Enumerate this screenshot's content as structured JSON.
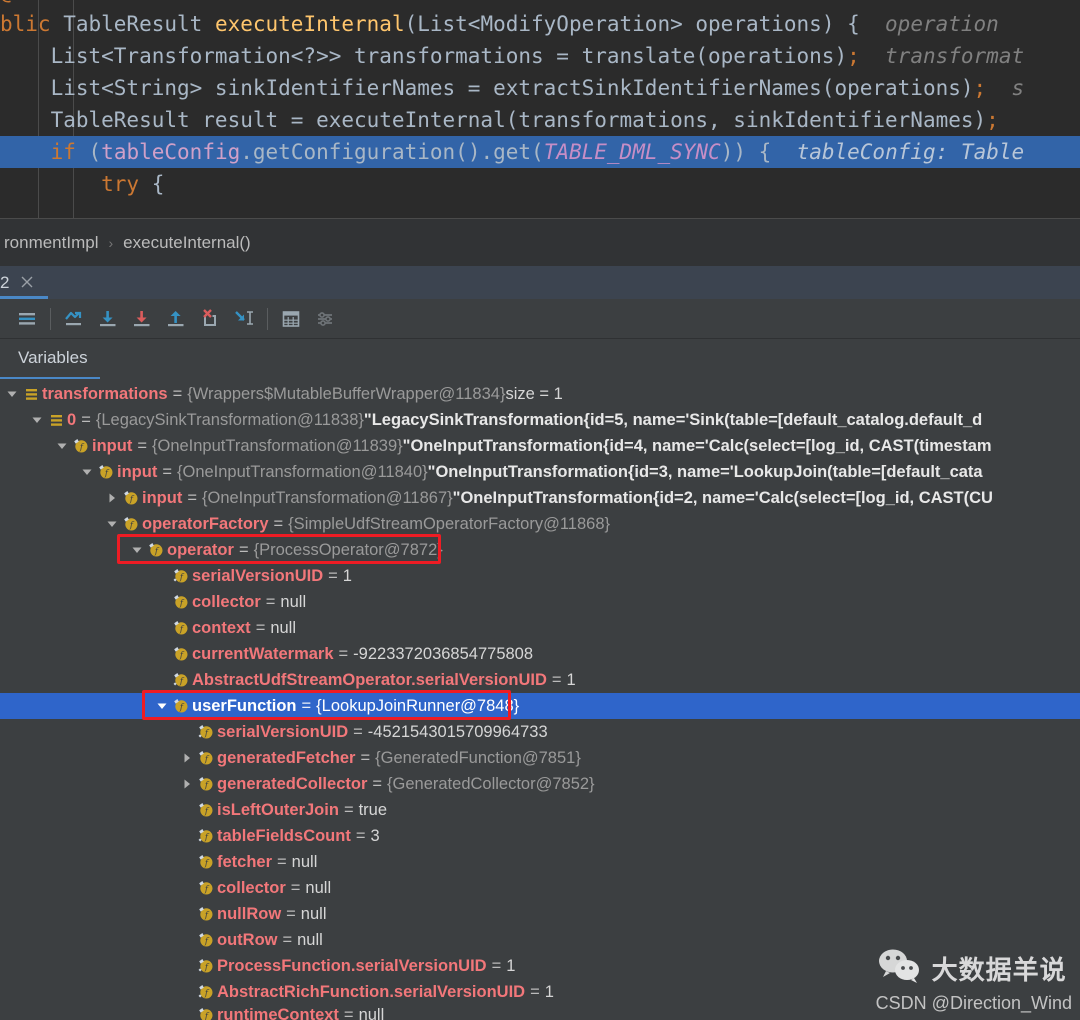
{
  "app": "IntelliJ IDEA Debugger",
  "editor": {
    "lines": [
      {
        "id": "line-override",
        "clipped_top": true,
        "selected": false,
        "segments": [
          {
            "cls": "kw",
            "t": "@Override"
          }
        ],
        "hint": ""
      },
      {
        "id": "line-signature",
        "selected": false,
        "segments": [
          {
            "cls": "kw",
            "t": "blic "
          },
          {
            "cls": "plain",
            "t": "TableResult "
          },
          {
            "cls": "mth",
            "t": "executeInternal"
          },
          {
            "cls": "plain",
            "t": "(List<ModifyOperation> operations) {"
          }
        ],
        "hint": "operation"
      },
      {
        "id": "line-transformations",
        "selected": false,
        "segments": [
          {
            "cls": "plain",
            "t": "    List<Transformation<?>> transformations = translate(operations)"
          },
          {
            "cls": "punc",
            "t": ";"
          }
        ],
        "hint": "transformat"
      },
      {
        "id": "line-sinknames",
        "selected": false,
        "segments": [
          {
            "cls": "plain",
            "t": "    List<String> sinkIdentifierNames = extractSinkIdentifierNames(operations)"
          },
          {
            "cls": "punc",
            "t": ";"
          }
        ],
        "hint": "s"
      },
      {
        "id": "line-result",
        "selected": false,
        "segments": [
          {
            "cls": "plain",
            "t": "    TableResult result = executeInternal(transformations, sinkIdentifierNames)"
          },
          {
            "cls": "punc",
            "t": ";"
          }
        ],
        "hint": ""
      },
      {
        "id": "line-if",
        "selected": true,
        "segments": [
          {
            "cls": "kw",
            "t": "    if "
          },
          {
            "cls": "plain",
            "t": "("
          },
          {
            "cls": "fld",
            "t": "tableConfig"
          },
          {
            "cls": "plain",
            "t": ".getConfiguration().get("
          },
          {
            "cls": "stat",
            "t": "TABLE_DML_SYNC"
          },
          {
            "cls": "plain",
            "t": ")) {"
          }
        ],
        "hint": "tableConfig: Table"
      },
      {
        "id": "line-try",
        "selected": false,
        "segments": [
          {
            "cls": "kw",
            "t": "        try "
          },
          {
            "cls": "plain",
            "t": "{"
          }
        ],
        "hint": ""
      }
    ]
  },
  "breadcrumb": {
    "items": [
      "ronmentImpl",
      "executeInternal()"
    ],
    "separator": "›"
  },
  "debug_tab": {
    "label": "2",
    "close_icon": "close-icon"
  },
  "toolbar": {
    "buttons": [
      {
        "name": "show-execution-point-button",
        "icon": "lines-icon",
        "title": "Show Execution Point"
      },
      {
        "name": "step-over-button",
        "icon": "step-over-icon",
        "title": "Step Over"
      },
      {
        "name": "step-into-button",
        "icon": "step-into-icon",
        "title": "Step Into"
      },
      {
        "name": "force-step-into-button",
        "icon": "force-step-into-icon",
        "title": "Force Step Into"
      },
      {
        "name": "step-out-button",
        "icon": "step-out-icon",
        "title": "Step Out"
      },
      {
        "name": "drop-frame-button",
        "icon": "drop-frame-icon",
        "title": "Drop Frame"
      },
      {
        "name": "run-to-cursor-button",
        "icon": "run-to-cursor-icon",
        "title": "Run to Cursor"
      },
      {
        "name": "evaluate-expression-button",
        "icon": "calculator-icon",
        "title": "Evaluate Expression"
      },
      {
        "name": "settings-button",
        "icon": "sliders-icon",
        "title": "Settings"
      }
    ]
  },
  "variables_panel": {
    "title": "Variables"
  },
  "tree": {
    "rows": [
      {
        "indent": 0,
        "arrow": "down",
        "icon": "array-icon",
        "selected": false,
        "name": "transformations",
        "ref": "{Wrappers$MutableBufferWrapper@11834}",
        "extra": "size = 1",
        "extra_kind": "val"
      },
      {
        "indent": 1,
        "arrow": "down",
        "icon": "array-icon",
        "selected": false,
        "name": "0",
        "ref": "{LegacySinkTransformation@11838}",
        "extra": "\"LegacySinkTransformation{id=5, name='Sink(table=[default_catalog.default_d",
        "extra_kind": "str"
      },
      {
        "indent": 2,
        "arrow": "down",
        "icon": "field-icon",
        "selected": false,
        "name": "input",
        "ref": "{OneInputTransformation@11839}",
        "extra": "\"OneInputTransformation{id=4, name='Calc(select=[log_id, CAST(timestam",
        "extra_kind": "str"
      },
      {
        "indent": 3,
        "arrow": "down",
        "icon": "field-icon",
        "selected": false,
        "name": "input",
        "ref": "{OneInputTransformation@11840}",
        "extra": "\"OneInputTransformation{id=3, name='LookupJoin(table=[default_cata",
        "extra_kind": "str"
      },
      {
        "indent": 4,
        "arrow": "right",
        "icon": "field-icon",
        "selected": false,
        "name": "input",
        "ref": "{OneInputTransformation@11867}",
        "extra": "\"OneInputTransformation{id=2, name='Calc(select=[log_id, CAST(CU",
        "extra_kind": "str"
      },
      {
        "indent": 4,
        "arrow": "down",
        "icon": "field-icon",
        "selected": false,
        "name": "operatorFactory",
        "ref": "{SimpleUdfStreamOperatorFactory@11868}",
        "extra": "",
        "extra_kind": "val"
      },
      {
        "indent": 5,
        "arrow": "down",
        "icon": "field-icon",
        "selected": false,
        "boxed": true,
        "name": "operator",
        "ref": "{ProcessOperator@7872}",
        "extra": "",
        "extra_kind": "val"
      },
      {
        "indent": 6,
        "arrow": "none",
        "icon": "static-field-icon",
        "selected": false,
        "name": "serialVersionUID",
        "ref": "",
        "extra": "1",
        "extra_kind": "num"
      },
      {
        "indent": 6,
        "arrow": "none",
        "icon": "field-icon",
        "selected": false,
        "name": "collector",
        "ref": "",
        "extra": "null",
        "extra_kind": "val"
      },
      {
        "indent": 6,
        "arrow": "none",
        "icon": "field-icon",
        "selected": false,
        "name": "context",
        "ref": "",
        "extra": "null",
        "extra_kind": "val"
      },
      {
        "indent": 6,
        "arrow": "none",
        "icon": "field-icon",
        "selected": false,
        "name": "currentWatermark",
        "ref": "",
        "extra": "-9223372036854775808",
        "extra_kind": "num"
      },
      {
        "indent": 6,
        "arrow": "none",
        "icon": "static-field-icon",
        "selected": false,
        "name": "AbstractUdfStreamOperator.serialVersionUID",
        "ref": "",
        "extra": "1",
        "extra_kind": "num"
      },
      {
        "indent": 6,
        "arrow": "down",
        "icon": "field-icon",
        "selected": true,
        "boxed": true,
        "name": "userFunction",
        "ref": "{LookupJoinRunner@7848}",
        "extra": "",
        "extra_kind": "val"
      },
      {
        "indent": 7,
        "arrow": "none",
        "icon": "static-field-icon",
        "selected": false,
        "name": "serialVersionUID",
        "ref": "",
        "extra": "-4521543015709964733",
        "extra_kind": "num"
      },
      {
        "indent": 7,
        "arrow": "right",
        "icon": "field-icon",
        "selected": false,
        "name": "generatedFetcher",
        "ref": "{GeneratedFunction@7851}",
        "extra": "",
        "extra_kind": "val"
      },
      {
        "indent": 7,
        "arrow": "right",
        "icon": "field-icon",
        "selected": false,
        "name": "generatedCollector",
        "ref": "{GeneratedCollector@7852}",
        "extra": "",
        "extra_kind": "val"
      },
      {
        "indent": 7,
        "arrow": "none",
        "icon": "field-icon",
        "selected": false,
        "name": "isLeftOuterJoin",
        "ref": "",
        "extra": "true",
        "extra_kind": "val"
      },
      {
        "indent": 7,
        "arrow": "none",
        "icon": "static-field-icon",
        "selected": false,
        "name": "tableFieldsCount",
        "ref": "",
        "extra": "3",
        "extra_kind": "num"
      },
      {
        "indent": 7,
        "arrow": "none",
        "icon": "field-icon",
        "selected": false,
        "name": "fetcher",
        "ref": "",
        "extra": "null",
        "extra_kind": "val"
      },
      {
        "indent": 7,
        "arrow": "none",
        "icon": "field-icon",
        "selected": false,
        "name": "collector",
        "ref": "",
        "extra": "null",
        "extra_kind": "val"
      },
      {
        "indent": 7,
        "arrow": "none",
        "icon": "field-icon",
        "selected": false,
        "name": "nullRow",
        "ref": "",
        "extra": "null",
        "extra_kind": "val"
      },
      {
        "indent": 7,
        "arrow": "none",
        "icon": "field-icon",
        "selected": false,
        "name": "outRow",
        "ref": "",
        "extra": "null",
        "extra_kind": "val"
      },
      {
        "indent": 7,
        "arrow": "none",
        "icon": "static-field-icon",
        "selected": false,
        "name": "ProcessFunction.serialVersionUID",
        "ref": "",
        "extra": "1",
        "extra_kind": "num"
      },
      {
        "indent": 7,
        "arrow": "none",
        "icon": "static-field-icon",
        "selected": false,
        "name": "AbstractRichFunction.serialVersionUID",
        "ref": "",
        "extra": "1",
        "extra_kind": "num"
      },
      {
        "indent": 7,
        "arrow": "none",
        "icon": "field-icon",
        "selected": false,
        "clipped": true,
        "name": "runtimeContext",
        "ref": "",
        "extra": "null",
        "extra_kind": "val"
      }
    ]
  },
  "watermark": {
    "icon": "wechat-icon",
    "title": "大数据羊说",
    "subtitle": "CSDN @Direction_Wind"
  },
  "colors": {
    "editor_bg": "#2b2b2b",
    "panel_bg": "#3c3f41",
    "selection_blue": "#2f65ca",
    "code_selection_blue": "#3264a8",
    "accent_blue": "#4a88c7",
    "field_red": "#f2777a",
    "keyword_orange": "#cc7832",
    "method_yellow": "#ffc66d",
    "box_red": "#ee1c24"
  }
}
